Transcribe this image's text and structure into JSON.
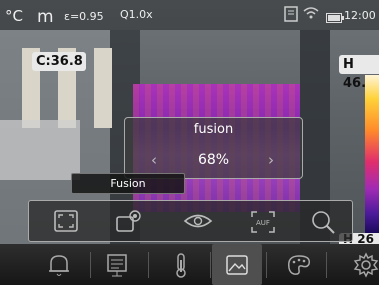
{
  "status": {
    "temp_unit": "°C",
    "distance_unit": "m",
    "emissivity": "ε=0.95",
    "zoom": "Q1.0x",
    "time": "12:00"
  },
  "readouts": {
    "center": "C:36.8",
    "high": "H 46.",
    "low": "H 26"
  },
  "fusion_dialog": {
    "title": "fusion",
    "value": "68%",
    "prev_arrow": "‹",
    "next_arrow": "›"
  },
  "mode_label": "Fusion",
  "tools": [
    "frame-icon",
    "camera-rotate-icon",
    "eye-icon",
    "auto-focus-icon",
    "magnifier-icon"
  ],
  "tool_labels": {
    "af": "AUF"
  },
  "menu": [
    "bell-icon",
    "document-icon",
    "thermometer-icon",
    "image-icon",
    "palette-icon",
    "gear-icon"
  ],
  "colors": {
    "accent": "#e02d6d",
    "thermal": "#a12bb4"
  }
}
